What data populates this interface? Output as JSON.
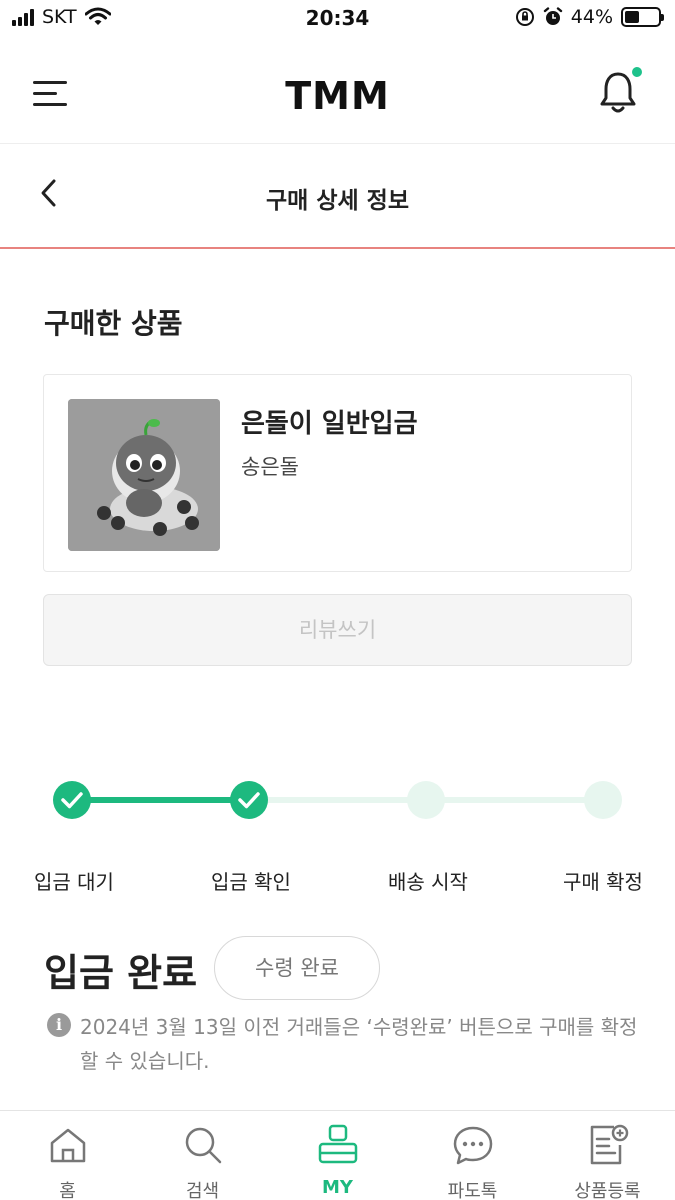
{
  "status_bar": {
    "carrier": "SKT",
    "time": "20:34",
    "battery": "44%",
    "battery_level": 0.44
  },
  "header": {
    "logo": "TMM"
  },
  "subheader": {
    "title": "구매 상세 정보"
  },
  "section": {
    "title": "구매한 상품"
  },
  "product": {
    "name": "은돌이 일반입금",
    "seller": "송은돌"
  },
  "review_button": {
    "label": "리뷰쓰기"
  },
  "progress": {
    "steps": [
      {
        "label": "입금 대기",
        "done": true
      },
      {
        "label": "입금 확인",
        "done": true
      },
      {
        "label": "배송 시작",
        "done": false
      },
      {
        "label": "구매 확정",
        "done": false
      }
    ]
  },
  "status": {
    "title": "입금 완료",
    "receipt_button": "수령 완료",
    "notice": "2024년 3월 13일 이전 거래들은 ‘수령완료’ 버튼으로 구매를 확정할 수 있습니다."
  },
  "tabs": [
    {
      "label": "홈",
      "icon": "home-icon",
      "active": false
    },
    {
      "label": "검색",
      "icon": "search-icon",
      "active": false
    },
    {
      "label": "MY",
      "icon": "my-icon",
      "active": true
    },
    {
      "label": "파도톡",
      "icon": "chat-icon",
      "active": false
    },
    {
      "label": "상품등록",
      "icon": "register-icon",
      "active": false
    }
  ],
  "colors": {
    "accent": "#1db97f",
    "divider": "#e8837f",
    "track_inactive": "#e7f6ef"
  }
}
